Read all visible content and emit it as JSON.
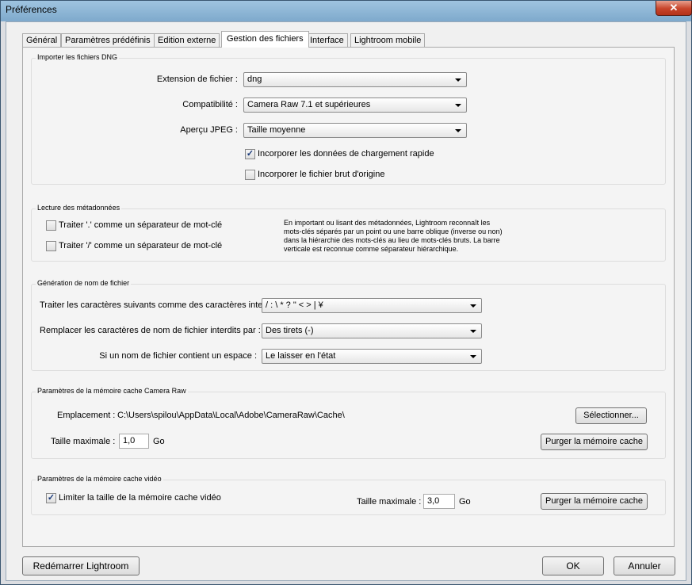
{
  "window": {
    "title": "Préférences",
    "close_glyph": "✕"
  },
  "tabs": [
    {
      "label": "Général"
    },
    {
      "label": "Paramètres prédéfinis"
    },
    {
      "label": "Edition externe"
    },
    {
      "label": "Gestion des fichiers",
      "active": true
    },
    {
      "label": "Interface"
    },
    {
      "label": "Lightroom mobile"
    }
  ],
  "dng": {
    "title": "Importer les fichiers DNG",
    "extension_label": "Extension de fichier :",
    "extension_value": "dng",
    "compat_label": "Compatibilité :",
    "compat_value": "Camera Raw 7.1 et supérieures",
    "jpeg_label": "Aperçu JPEG :",
    "jpeg_value": "Taille moyenne",
    "fast_load_label": "Incorporer les données de chargement rapide",
    "fast_load_checked": true,
    "embed_raw_label": "Incorporer le fichier brut d'origine",
    "embed_raw_checked": false
  },
  "metadata": {
    "title": "Lecture des métadonnées",
    "dot_label": "Traiter '.' comme un séparateur de mot-clé",
    "dot_checked": false,
    "slash_label": "Traiter '/' comme un séparateur de mot-clé",
    "slash_checked": false,
    "note_lines": [
      "En important ou lisant des métadonnées, Lightroom reconnaît les",
      "mots-clés séparés par un point ou une barre oblique (inverse ou non)",
      "dans la hiérarchie des mots-clés au lieu de mots-clés bruts. La barre",
      "verticale est reconnue comme séparateur hiérarchique."
    ]
  },
  "naming": {
    "title": "Génération de nom de fichier",
    "illegal_label": "Traiter les caractères suivants comme des caractères interdits :",
    "illegal_value": "/ : \\ * ? \" < > | ¥",
    "replace_label": "Remplacer les caractères de nom de fichier interdits par :",
    "replace_value": "Des tirets (-)",
    "space_label": "Si un nom de fichier contient un espace :",
    "space_value": "Le laisser en l'état"
  },
  "camera_raw_cache": {
    "title": "Paramètres de la mémoire cache Camera Raw",
    "location_label": "Emplacement :",
    "location_value": "C:\\Users\\spilou\\AppData\\Local\\Adobe\\CameraRaw\\Cache\\",
    "select_button": "Sélectionner...",
    "max_size_label": "Taille maximale :",
    "max_size_value": "1,0",
    "unit": "Go",
    "purge_button": "Purger la mémoire cache"
  },
  "video_cache": {
    "title": "Paramètres de la mémoire cache vidéo",
    "limit_label": "Limiter la taille de la mémoire cache vidéo",
    "limit_checked": true,
    "max_size_label": "Taille maximale :",
    "max_size_value": "3,0",
    "unit": "Go",
    "purge_button": "Purger la mémoire cache"
  },
  "footer": {
    "restart_button": "Redémarrer Lightroom",
    "ok_button": "OK",
    "cancel_button": "Annuler"
  }
}
